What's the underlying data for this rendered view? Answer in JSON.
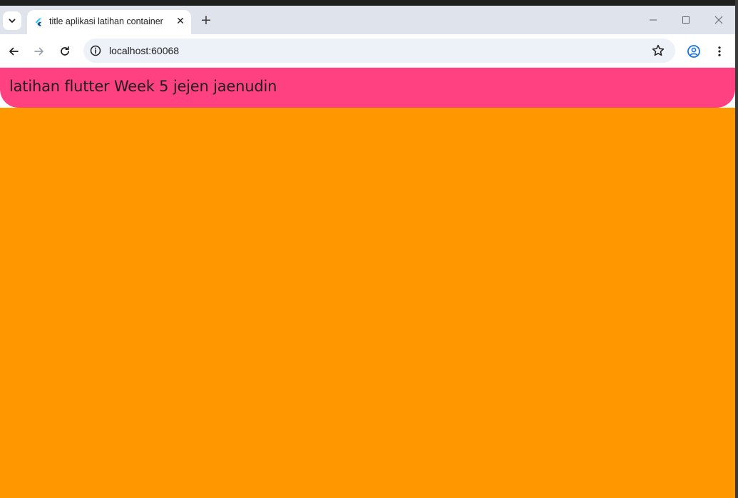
{
  "browser": {
    "tab": {
      "title": "title aplikasi latihan container",
      "close_glyph": "✕",
      "favicon": "flutter-icon"
    },
    "new_tab_glyph": "+",
    "address": {
      "url": "localhost:60068"
    },
    "icons": {
      "tab_search": "chevron-down-icon",
      "back": "arrow-left-icon",
      "forward": "arrow-right-icon",
      "reload": "reload-icon",
      "site_info": "info-icon",
      "bookmark": "star-icon",
      "profile": "profile-icon",
      "menu": "kebab-menu-icon",
      "minimize": "minimize-icon",
      "maximize": "maximize-icon",
      "close": "close-icon"
    }
  },
  "app": {
    "appbar_title": "latihan flutter Week 5 jejen jaenudin",
    "colors": {
      "appbar": "#ff4081",
      "body": "#ff9800"
    }
  }
}
